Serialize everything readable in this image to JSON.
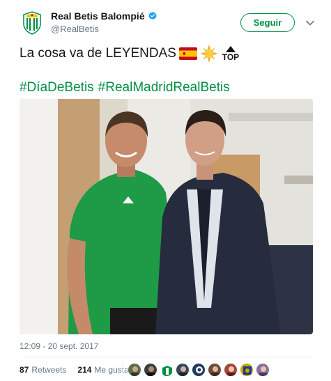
{
  "account": {
    "display_name": "Real Betis Balompié",
    "handle": "@RealBetis",
    "verified": true,
    "avatar_icon": "real-betis-crest-icon"
  },
  "follow_button": {
    "label": "Seguir"
  },
  "menu_icon": "chevron-down-icon",
  "tweet": {
    "text": "La cosa va de LEYENDAS",
    "emojis": [
      "spain-flag-icon",
      "sun-icon",
      "top-arrow-icon"
    ],
    "top_label": "TOP",
    "hashtags": [
      "#DíaDeBetis",
      "#RealMadridRealBetis"
    ]
  },
  "photo": {
    "icon": "photo-two-men-icon"
  },
  "timestamp": "12:09 - 20 sept. 2017",
  "stats": {
    "retweets_count": "87",
    "retweets_label": "Retweets",
    "likes_count": "214",
    "likes_label": "Me gusta"
  },
  "likers": [
    {
      "icon": "avatar-1"
    },
    {
      "icon": "avatar-2"
    },
    {
      "icon": "avatar-3"
    },
    {
      "icon": "avatar-4"
    },
    {
      "icon": "avatar-5"
    },
    {
      "icon": "avatar-6"
    },
    {
      "icon": "avatar-7"
    },
    {
      "icon": "avatar-8"
    },
    {
      "icon": "avatar-9"
    }
  ],
  "colors": {
    "accent": "#008e44",
    "verified": "#1da1f2",
    "text": "#14171a",
    "muted": "#657786"
  }
}
